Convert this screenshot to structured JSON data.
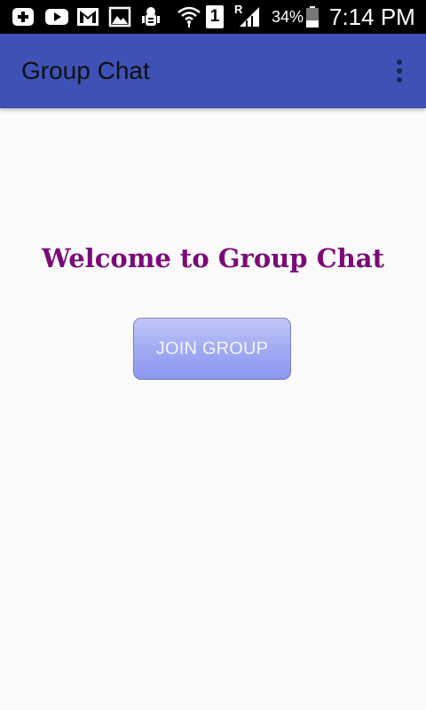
{
  "status_bar": {
    "time": "7:14 PM",
    "battery_percent": "34%",
    "sim_slot": "1",
    "roaming": "R",
    "icons": [
      "add-box-icon",
      "youtube-icon",
      "gmail-icon",
      "gallery-icon",
      "android-debug-icon",
      "wifi-icon",
      "sim-icon",
      "signal-icon",
      "battery-icon"
    ]
  },
  "app_bar": {
    "title": "Group Chat",
    "background": "#3f51b5",
    "menu_icon": "more-vert-icon"
  },
  "main": {
    "welcome_text": "Welcome to Group Chat",
    "welcome_color": "#7b0a78",
    "join_button_label": "JOIN GROUP"
  }
}
